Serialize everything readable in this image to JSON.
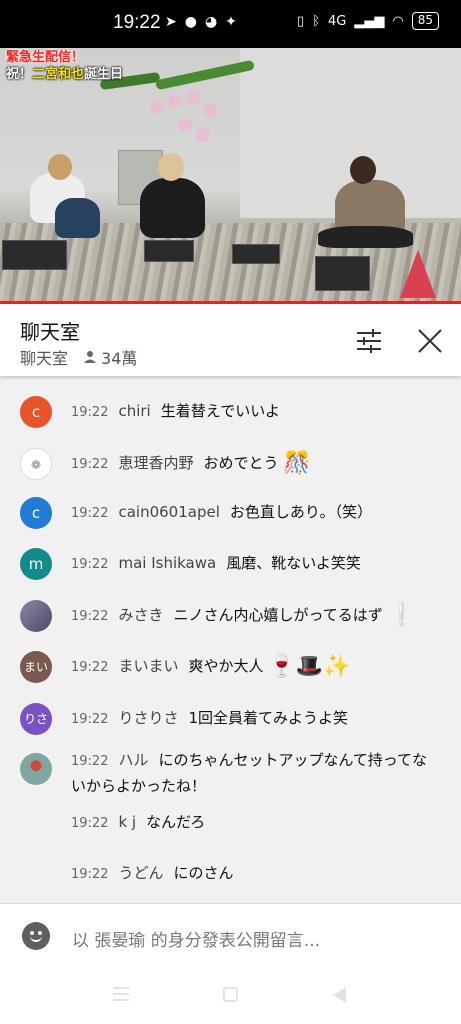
{
  "status_bar": {
    "time": "19:22",
    "left_icons": [
      "telegram-icon",
      "line-icon",
      "ghost-icon",
      "twitter-icon"
    ],
    "network_text": "4G",
    "battery": "85"
  },
  "video": {
    "overlay_line1": "緊急生配信！",
    "overlay_line2_prefix": "祝！",
    "overlay_line2_name": "二宮和也",
    "overlay_line2_suffix": "誕生日",
    "progress_color": "#e52222"
  },
  "chat_header": {
    "title": "聊天室",
    "subtitle": "聊天室",
    "viewer_count": "34萬"
  },
  "messages": [
    {
      "avatar_text": "c",
      "avatar_color": "#e8542a",
      "time": "19:22",
      "author": "chiri",
      "text": "生着替えでいいよ",
      "emoji": ""
    },
    {
      "avatar_text": "",
      "avatar_color": "#ffffff",
      "time": "19:22",
      "author": "恵理香内野",
      "text": "おめでとう",
      "emoji": "🎊"
    },
    {
      "avatar_text": "c",
      "avatar_color": "#1f7bd6",
      "time": "19:22",
      "author": "cain0601apel",
      "text": "お色直しあり。（笑）",
      "emoji": ""
    },
    {
      "avatar_text": "m",
      "avatar_color": "#128c8a",
      "time": "19:22",
      "author": "mai Ishikawa",
      "text": "風磨、靴ないよ笑笑",
      "emoji": ""
    },
    {
      "avatar_text": "",
      "avatar_color": "#6c6a8a",
      "time": "19:22",
      "author": "みさき",
      "text": "ニノさん内心嬉しがってるはず",
      "emoji": "❕"
    },
    {
      "avatar_text": "まい",
      "avatar_color": "#7a5a50",
      "time": "19:22",
      "author": "まいまい",
      "text": "爽やか大人",
      "emoji": "🍷🎩✨"
    },
    {
      "avatar_text": "りさ",
      "avatar_color": "#7b52c4",
      "time": "19:22",
      "author": "りさりさ",
      "text": "1回全員着てみようよ笑",
      "emoji": ""
    },
    {
      "avatar_text": "",
      "avatar_color": "#7fa6a0",
      "time": "19:22",
      "author": "ハル",
      "text": "にのちゃんセットアップなんて持ってないからよかったね！",
      "emoji": ""
    },
    {
      "avatar_text": "",
      "avatar_color": "",
      "time": "19:22",
      "author": "k j",
      "text": "なんだろ",
      "emoji": ""
    },
    {
      "avatar_text": "",
      "avatar_color": "",
      "time": "19:22",
      "author": "うどん",
      "text": "にのさん",
      "emoji": ""
    }
  ],
  "input": {
    "placeholder": "以 張晏瑜 的身分發表公開留言..."
  }
}
